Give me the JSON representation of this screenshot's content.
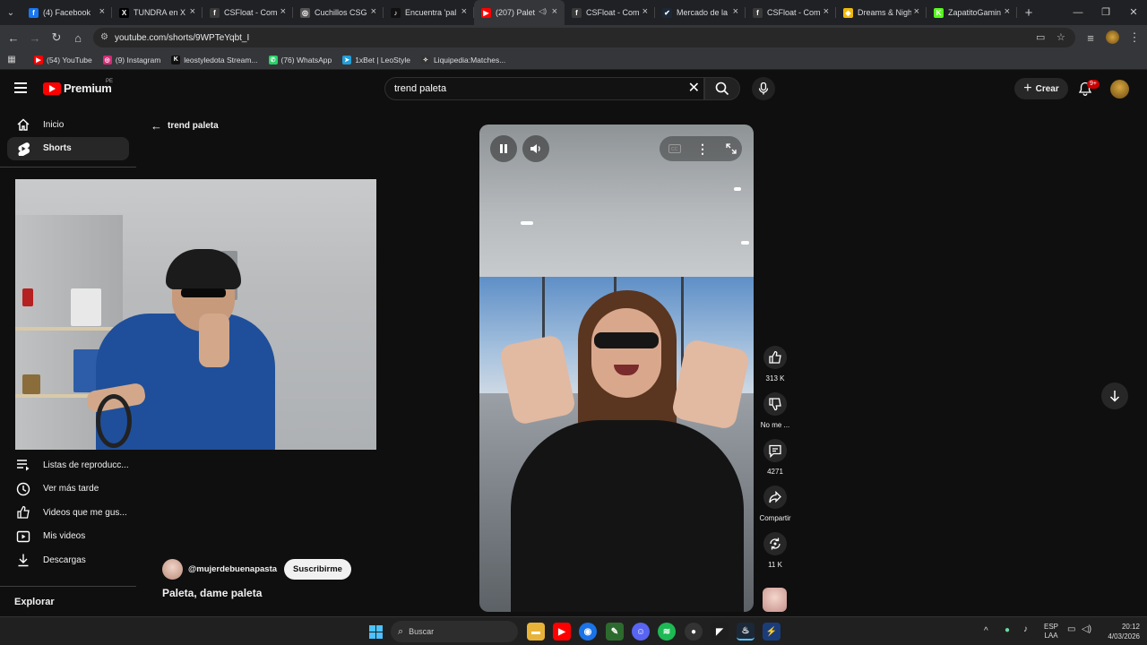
{
  "browser": {
    "tabs": [
      {
        "label": "(4) Facebook",
        "icon": "facebook-icon",
        "color": "#1877f2",
        "glyph": "f"
      },
      {
        "label": "TUNDRA en X",
        "icon": "x-icon",
        "color": "#000000",
        "glyph": "X"
      },
      {
        "label": "CSFloat - Com",
        "icon": "csfloat-icon",
        "color": "#3a3a3a",
        "glyph": "f"
      },
      {
        "label": "Cuchillos CSG",
        "icon": "csgo-icon",
        "color": "#555555",
        "glyph": "◎"
      },
      {
        "label": "Encuentra 'pal",
        "icon": "tiktok-icon",
        "color": "#111111",
        "glyph": "♪"
      },
      {
        "label": "(207) Palet",
        "icon": "youtube-icon",
        "color": "#ff0000",
        "glyph": "▶",
        "active": true
      },
      {
        "label": "CSFloat - Com",
        "icon": "csfloat-icon",
        "color": "#3a3a3a",
        "glyph": "f"
      },
      {
        "label": "Mercado de la",
        "icon": "steam-icon",
        "color": "#1b2838",
        "glyph": "✔"
      },
      {
        "label": "CSFloat - Com",
        "icon": "csfloat-icon",
        "color": "#3a3a3a",
        "glyph": "f"
      },
      {
        "label": "Dreams & Nigh",
        "icon": "binance-icon",
        "color": "#f0b90b",
        "glyph": "◆"
      },
      {
        "label": "ZapatitoGamin",
        "icon": "kick-icon",
        "color": "#53fc18",
        "glyph": "K"
      }
    ],
    "url": "youtube.com/shorts/9WPTeYqbt_I",
    "bookmarks": [
      {
        "label": "(54) YouTube",
        "color": "#ff0000",
        "glyph": "▶"
      },
      {
        "label": "(9) Instagram",
        "color": "#d62976",
        "glyph": "◎"
      },
      {
        "label": "leostyledota Stream...",
        "color": "#111111",
        "glyph": "K"
      },
      {
        "label": "(76) WhatsApp",
        "color": "#25d366",
        "glyph": "✆"
      },
      {
        "label": "1xBet | LeoStyle",
        "color": "#229ed9",
        "glyph": "➤"
      },
      {
        "label": "Liquipedia:Matches...",
        "color": "#333333",
        "glyph": "✧"
      }
    ]
  },
  "youtube": {
    "logo_text": "Premium",
    "region": "PE",
    "search_value": "trend paleta",
    "create_label": "Crear",
    "notifications": "9+",
    "sidebar": {
      "top": [
        {
          "label": "Inicio",
          "icon": "home-icon"
        },
        {
          "label": "Shorts",
          "icon": "shorts-icon",
          "active": true
        }
      ],
      "you": [
        {
          "label": "Listas de reproducc...",
          "icon": "playlist-icon"
        },
        {
          "label": "Ver más tarde",
          "icon": "clock-icon"
        },
        {
          "label": "Videos que me gus...",
          "icon": "like-icon"
        },
        {
          "label": "Mis videos",
          "icon": "video-icon"
        },
        {
          "label": "Descargas",
          "icon": "download-icon"
        }
      ],
      "explore_heading": "Explorar"
    },
    "back_label": "trend paleta",
    "channel": "@mujerdebuenapasta",
    "subscribe_label": "Suscribirme",
    "video_title": "Paleta, dame paleta",
    "actions": [
      {
        "label": "313 K",
        "icon": "like-icon"
      },
      {
        "label": "No me ...",
        "icon": "dislike-icon"
      },
      {
        "label": "4271",
        "icon": "comment-icon"
      },
      {
        "label": "Compartir",
        "icon": "share-icon"
      },
      {
        "label": "11 K",
        "icon": "remix-icon"
      }
    ]
  },
  "taskbar": {
    "search_placeholder": "Buscar",
    "lang_top": "ESP",
    "lang_bottom": "LAA",
    "time": "20:12",
    "date": "4/03/2026"
  }
}
